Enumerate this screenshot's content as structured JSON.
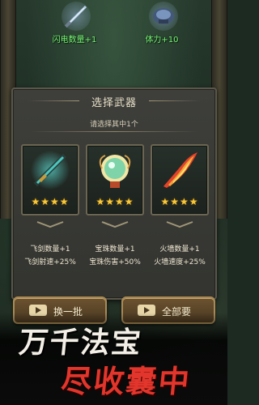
{
  "rewards": [
    {
      "icon": "lightning-sword-icon",
      "text": "闪电数量+1"
    },
    {
      "icon": "stamina-armor-icon",
      "text": "体力+10"
    }
  ],
  "panel": {
    "title": "选择武器",
    "subtitle": "请选择其中1个"
  },
  "cards": [
    {
      "icon": "flying-sword-icon",
      "stars": "★★★★",
      "line1": "飞剑数量+1",
      "line2": "飞剑射速+25%"
    },
    {
      "icon": "orb-icon",
      "stars": "★★★★",
      "line1": "宝珠数量+1",
      "line2": "宝珠伤害+50%"
    },
    {
      "icon": "fire-wall-icon",
      "stars": "★★★★",
      "line1": "火墙数量+1",
      "line2": "火墙速度+25%"
    }
  ],
  "buttons": {
    "swap_label": "换一批",
    "all_label": "全部要"
  },
  "slogan": {
    "line1": "万千法宝",
    "line2": "尽收囊中"
  },
  "colors": {
    "star": "#f7c83a",
    "reward_text": "#7af07a",
    "slogan_red": "#e2352b"
  }
}
